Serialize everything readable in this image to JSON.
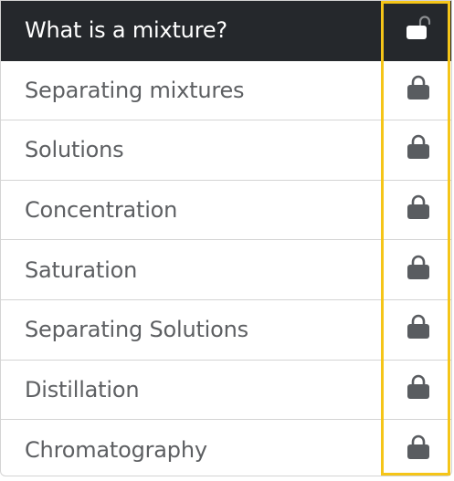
{
  "lessons": [
    {
      "label": "What is a mixture?",
      "status": "unlocked",
      "active": true,
      "icon": "unlocked-padlock-icon"
    },
    {
      "label": "Separating mixtures",
      "status": "locked",
      "icon": "padlock-icon"
    },
    {
      "label": "Solutions",
      "status": "locked",
      "icon": "padlock-icon"
    },
    {
      "label": "Concentration",
      "status": "locked",
      "icon": "padlock-icon"
    },
    {
      "label": "Saturation",
      "status": "locked",
      "icon": "padlock-icon"
    },
    {
      "label": "Separating Solutions",
      "status": "locked",
      "icon": "padlock-icon"
    },
    {
      "label": "Distillation",
      "status": "locked",
      "icon": "padlock-icon"
    },
    {
      "label": "Chromatography",
      "status": "locked",
      "icon": "padlock-icon"
    }
  ],
  "colors": {
    "active_row_bg": "#25282c",
    "active_text": "#ffffff",
    "text": "#5d5f62",
    "lock_icon": "#595c60",
    "highlight": "#f5c518",
    "border": "#d4d4d4"
  }
}
